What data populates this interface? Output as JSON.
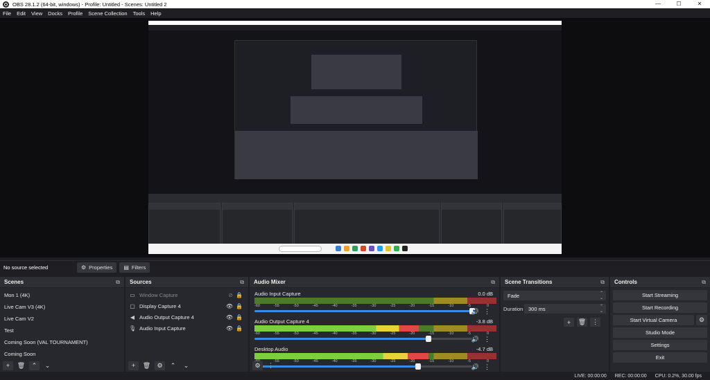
{
  "window": {
    "title": "OBS 28.1.2 (64-bit, windows) - Profile: Untitled - Scenes: Untitled 2",
    "minimize": "—",
    "maximize": "☐",
    "close": "✕"
  },
  "menu": [
    "File",
    "Edit",
    "View",
    "Docks",
    "Profile",
    "Scene Collection",
    "Tools",
    "Help"
  ],
  "toolbar": {
    "no_source": "No source selected",
    "properties": "Properties",
    "filters": "Filters"
  },
  "scenes": {
    "title": "Scenes",
    "items": [
      "Mon 1 (4K)",
      "Live Cam V3 (4K)",
      "Live Cam V2",
      "Test",
      "Coming Soon (VAL TOURNAMENT)",
      "Coming Soon"
    ]
  },
  "sources": {
    "title": "Sources",
    "items": [
      {
        "label": "Window Capture",
        "icon": "window-icon",
        "dim": true
      },
      {
        "label": "Display Capture 4",
        "icon": "monitor-icon",
        "dim": false
      },
      {
        "label": "Audio Output Capture 4",
        "icon": "speaker-icon",
        "dim": false
      },
      {
        "label": "Audio Input Capture",
        "icon": "microphone-icon",
        "dim": false
      }
    ]
  },
  "mixer": {
    "title": "Audio Mixer",
    "ticks": [
      "-60",
      "-55",
      "-50",
      "-45",
      "-40",
      "-35",
      "-30",
      "-25",
      "-20",
      "-15",
      "-10",
      "-5",
      "0"
    ],
    "channels": [
      {
        "name": "Audio Input Capture",
        "db": "0.0 dB",
        "level": 0.0,
        "volume": 1.0
      },
      {
        "name": "Audio Output Capture 4",
        "db": "-3.8 dB",
        "level": 0.68,
        "volume": 0.8
      },
      {
        "name": "Desktop Audio",
        "db": "-4.7 dB",
        "level": 0.72,
        "volume": 0.75
      }
    ]
  },
  "transitions": {
    "title": "Scene Transitions",
    "type": "Fade",
    "duration_label": "Duration",
    "duration": "300 ms"
  },
  "controls": {
    "title": "Controls",
    "start_streaming": "Start Streaming",
    "start_recording": "Start Recording",
    "start_virtual_camera": "Start Virtual Camera",
    "studio_mode": "Studio Mode",
    "settings": "Settings",
    "exit": "Exit"
  },
  "status": {
    "live": "LIVE: 00:00:00",
    "rec": "REC: 00:00:00",
    "cpu": "CPU: 0.2%, 30.00 fps"
  },
  "colors": {
    "accent": "#3d8ae0",
    "meter_green": "#7dcf3c",
    "meter_yellow": "#e8d13a",
    "meter_red": "#e04848"
  }
}
